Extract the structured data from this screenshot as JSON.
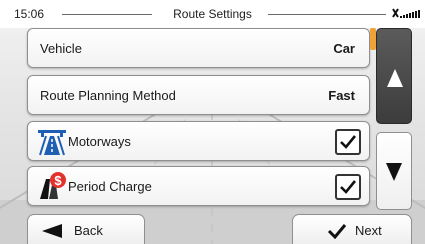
{
  "status": {
    "time": "15:06",
    "title": "Route Settings"
  },
  "rows": [
    {
      "label": "Vehicle",
      "value": "Car"
    },
    {
      "label": "Route Planning Method",
      "value": "Fast"
    },
    {
      "label": "Motorways",
      "checked": true,
      "icon": "motorway-icon"
    },
    {
      "label": "Period Charge",
      "checked": true,
      "icon": "toll-charge-icon"
    }
  ],
  "footer": {
    "back_label": "Back",
    "next_label": "Next"
  },
  "colors": {
    "accent": "#f0a23a",
    "scroll_dark": "#4a4a4a",
    "motorway_blue": "#1e5fb5",
    "toll_red": "#e3312d"
  }
}
